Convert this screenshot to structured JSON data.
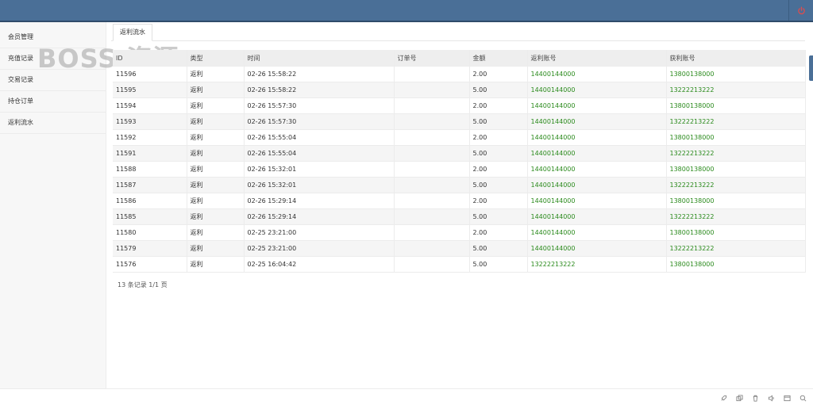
{
  "watermark": "BOSS 资源",
  "sidebar": {
    "items": [
      {
        "label": "会员管理"
      },
      {
        "label": "充值记录"
      },
      {
        "label": "交易记录"
      },
      {
        "label": "持仓订单"
      },
      {
        "label": "返利流水"
      }
    ]
  },
  "tab": {
    "label": "返利流水"
  },
  "table": {
    "headers": [
      "ID",
      "类型",
      "时间",
      "订单号",
      "金额",
      "返利账号",
      "获利账号"
    ],
    "rows": [
      [
        "11596",
        "返利",
        "02-26 15:58:22",
        "",
        "2.00",
        "14400144000",
        "13800138000"
      ],
      [
        "11595",
        "返利",
        "02-26 15:58:22",
        "",
        "5.00",
        "14400144000",
        "13222213222"
      ],
      [
        "11594",
        "返利",
        "02-26 15:57:30",
        "",
        "2.00",
        "14400144000",
        "13800138000"
      ],
      [
        "11593",
        "返利",
        "02-26 15:57:30",
        "",
        "5.00",
        "14400144000",
        "13222213222"
      ],
      [
        "11592",
        "返利",
        "02-26 15:55:04",
        "",
        "2.00",
        "14400144000",
        "13800138000"
      ],
      [
        "11591",
        "返利",
        "02-26 15:55:04",
        "",
        "5.00",
        "14400144000",
        "13222213222"
      ],
      [
        "11588",
        "返利",
        "02-26 15:32:01",
        "",
        "2.00",
        "14400144000",
        "13800138000"
      ],
      [
        "11587",
        "返利",
        "02-26 15:32:01",
        "",
        "5.00",
        "14400144000",
        "13222213222"
      ],
      [
        "11586",
        "返利",
        "02-26 15:29:14",
        "",
        "2.00",
        "14400144000",
        "13800138000"
      ],
      [
        "11585",
        "返利",
        "02-26 15:29:14",
        "",
        "5.00",
        "14400144000",
        "13222213222"
      ],
      [
        "11580",
        "返利",
        "02-25 23:21:00",
        "",
        "2.00",
        "14400144000",
        "13800138000"
      ],
      [
        "11579",
        "返利",
        "02-25 23:21:00",
        "",
        "5.00",
        "14400144000",
        "13222213222"
      ],
      [
        "11576",
        "返利",
        "02-25 16:04:42",
        "",
        "5.00",
        "13222213222",
        "13800138000"
      ]
    ]
  },
  "pager": {
    "text": "13 条记录 1/1 页"
  },
  "colors": {
    "topbar": "#4a6f97",
    "account_green": "#2a8a1c",
    "power_red": "#e24b4b"
  },
  "icons": [
    "power-icon",
    "rocket-icon",
    "copy-icon",
    "trash-icon",
    "volume-icon",
    "window-icon",
    "search-icon"
  ]
}
